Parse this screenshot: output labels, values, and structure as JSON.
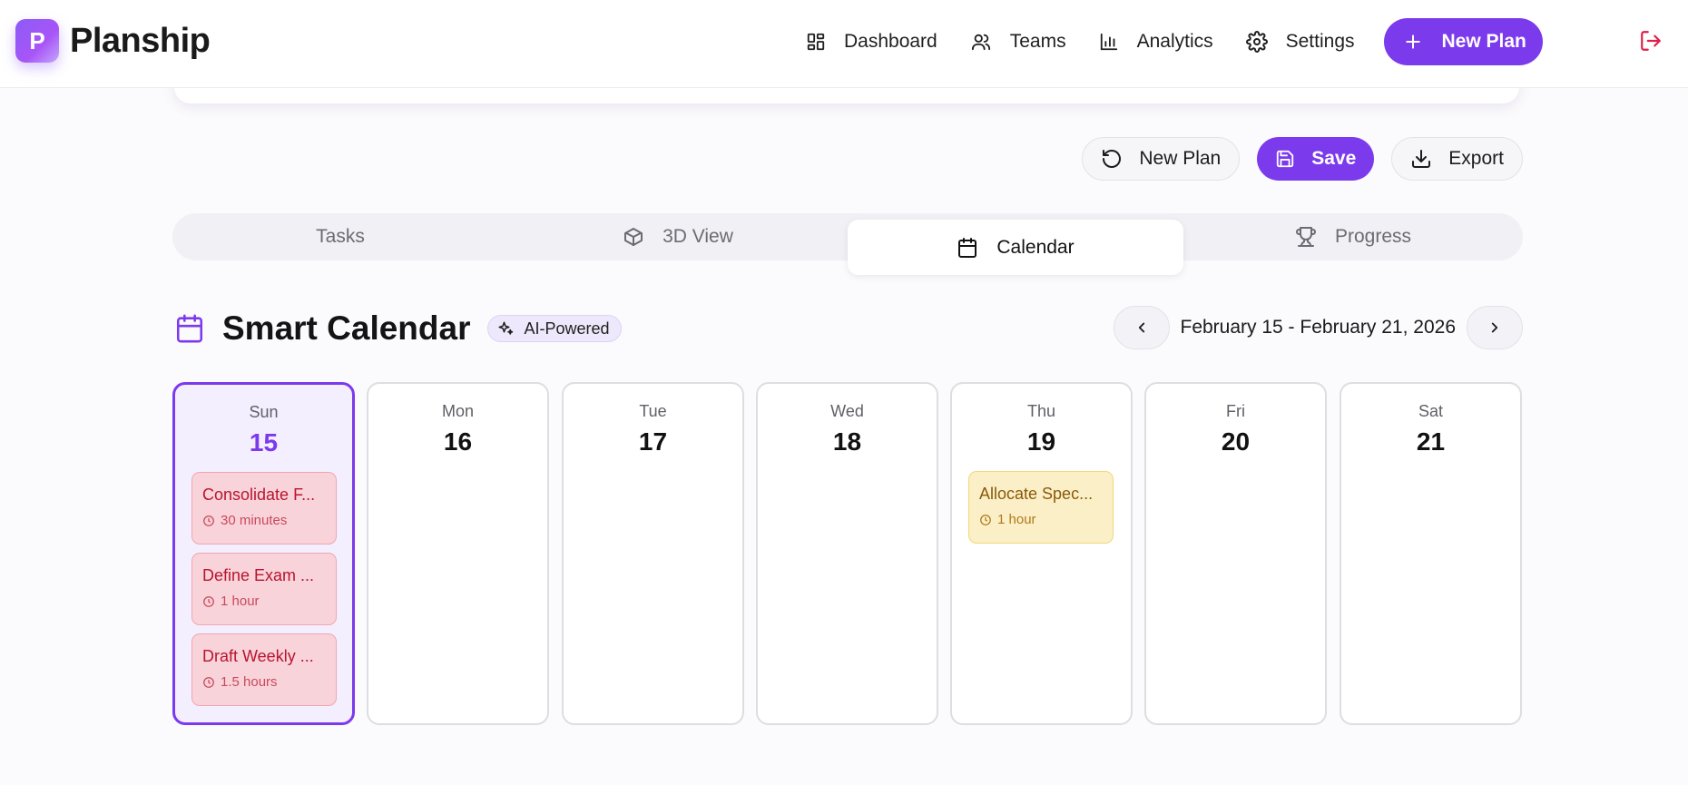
{
  "app": {
    "logo_letter": "P",
    "name": "Planship"
  },
  "nav": {
    "items": [
      {
        "label": "Dashboard",
        "icon": "dashboard-icon"
      },
      {
        "label": "Teams",
        "icon": "users-icon"
      },
      {
        "label": "Analytics",
        "icon": "bar-chart-icon"
      },
      {
        "label": "Settings",
        "icon": "gear-icon"
      }
    ],
    "new_plan_label": "New Plan",
    "logout_icon": "logout-icon"
  },
  "actions": {
    "new_plan_label": "New Plan",
    "save_label": "Save",
    "export_label": "Export"
  },
  "tabs": [
    {
      "label": "Tasks",
      "icon": "",
      "active": false
    },
    {
      "label": "3D View",
      "icon": "cube-icon",
      "active": false
    },
    {
      "label": "Calendar",
      "icon": "calendar-icon",
      "active": true
    },
    {
      "label": "Progress",
      "icon": "trophy-icon",
      "active": false
    }
  ],
  "calendar": {
    "title": "Smart Calendar",
    "badge": "AI-Powered",
    "range": "February 15 - February 21, 2026",
    "days": [
      {
        "dow": "Sun",
        "num": "15",
        "today": true,
        "tasks": [
          {
            "name": "Consolidate F...",
            "duration": "30 minutes",
            "color": "red"
          },
          {
            "name": "Define Exam ...",
            "duration": "1 hour",
            "color": "red"
          },
          {
            "name": "Draft Weekly ...",
            "duration": "1.5 hours",
            "color": "red"
          }
        ]
      },
      {
        "dow": "Mon",
        "num": "16",
        "tasks": []
      },
      {
        "dow": "Tue",
        "num": "17",
        "tasks": []
      },
      {
        "dow": "Wed",
        "num": "18",
        "tasks": []
      },
      {
        "dow": "Thu",
        "num": "19",
        "tasks": [
          {
            "name": "Allocate Spec...",
            "duration": "1 hour",
            "color": "yellow"
          }
        ]
      },
      {
        "dow": "Fri",
        "num": "20",
        "tasks": []
      },
      {
        "dow": "Sat",
        "num": "21",
        "tasks": []
      }
    ]
  },
  "colors": {
    "accent": "#7c3aed",
    "task_red_bg": "#f9d3da",
    "task_yellow_bg": "#fbefc8",
    "logout": "#e11d48"
  }
}
